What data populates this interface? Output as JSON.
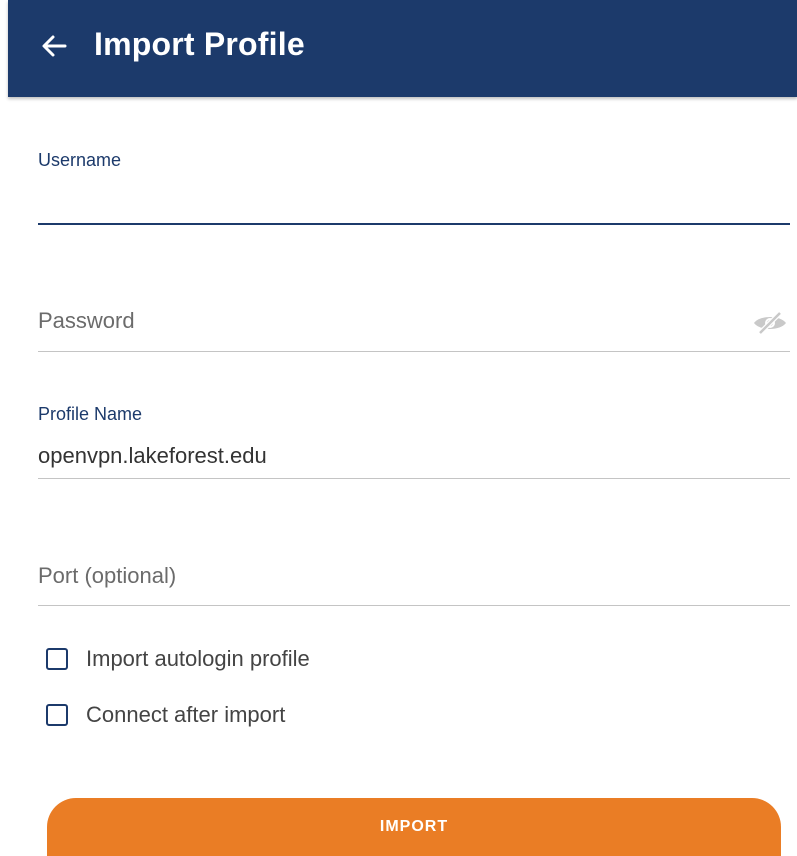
{
  "app_bar": {
    "title": "Import Profile",
    "back_icon": "arrow-left-icon",
    "color": "#1c3a6b"
  },
  "form": {
    "username": {
      "label": "Username",
      "value": ""
    },
    "password": {
      "label": "Password",
      "value": "",
      "toggle_icon": "eye-slash-icon"
    },
    "profile_name": {
      "label": "Profile Name",
      "value": "openvpn.lakeforest.edu"
    },
    "port": {
      "label": "Port (optional)",
      "value": ""
    }
  },
  "options": [
    {
      "label": "Import autologin profile",
      "checked": false
    },
    {
      "label": "Connect after import",
      "checked": false
    }
  ],
  "actions": {
    "import_label": "IMPORT",
    "import_color": "#ea7d25"
  }
}
